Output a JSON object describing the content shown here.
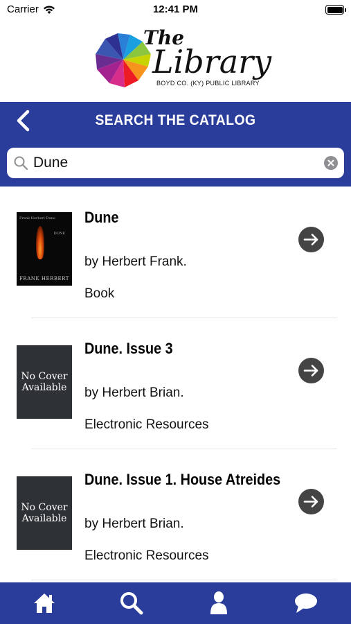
{
  "status_bar": {
    "carrier": "Carrier",
    "time": "12:41 PM"
  },
  "logo": {
    "the": "The",
    "library": "Library",
    "subtitle": "BOYD CO. (KY) PUBLIC LIBRARY"
  },
  "header": {
    "title": "SEARCH THE CATALOG",
    "back_icon": "chevron-left-icon"
  },
  "search": {
    "value": "Dune",
    "search_icon": "search-icon",
    "clear_icon": "clear-icon"
  },
  "results": [
    {
      "title": "Dune",
      "author": "by Herbert Frank.",
      "type": "Book",
      "cover": {
        "kind": "image",
        "top_text": "Frank Herbert Dune",
        "title_text": "DUNE",
        "author_text": "FRANK HERBERT"
      }
    },
    {
      "title": "Dune. Issue 3",
      "author": "by Herbert Brian.",
      "type": "Electronic Resources",
      "cover": {
        "kind": "placeholder",
        "text_line1": "No Cover",
        "text_line2": "Available"
      }
    },
    {
      "title": "Dune. Issue 1. House Atreides",
      "author": "by Herbert Brian.",
      "type": "Electronic Resources",
      "cover": {
        "kind": "placeholder",
        "text_line1": "No Cover",
        "text_line2": "Available"
      }
    }
  ],
  "tab_bar": {
    "tabs": [
      "home-icon",
      "search-icon",
      "account-icon",
      "chat-icon"
    ]
  },
  "colors": {
    "brand_blue": "#2b3d9a",
    "arrow_button": "#444444",
    "no_cover_bg": "#2e3236"
  }
}
